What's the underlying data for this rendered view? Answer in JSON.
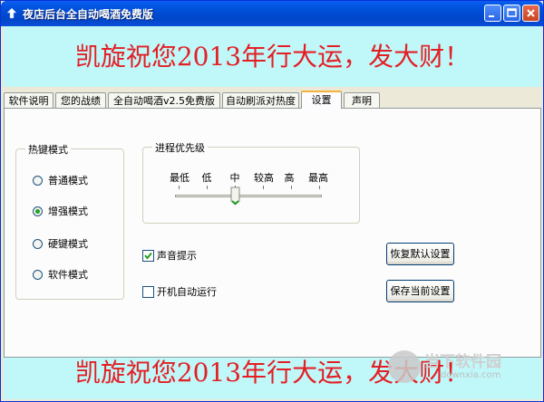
{
  "window": {
    "title": "夜店后台全自动喝酒免费版"
  },
  "banner": {
    "top_text": "凯旋祝您2013年行大运，发大财！",
    "bottom_text": "凯旋祝您2013年行大运，发大财！"
  },
  "tabs": [
    {
      "label": "软件说明",
      "active": false
    },
    {
      "label": "您的战绩",
      "active": false
    },
    {
      "label": "全自动喝酒v2.5免费版",
      "active": false
    },
    {
      "label": "自动刷派对热度",
      "active": false
    },
    {
      "label": "设置",
      "active": true
    },
    {
      "label": "声明",
      "active": false
    }
  ],
  "hotkey_group": {
    "title": "热键模式",
    "options": [
      {
        "label": "普通模式",
        "selected": false
      },
      {
        "label": "增强模式",
        "selected": true
      },
      {
        "label": "硬键模式",
        "selected": false
      },
      {
        "label": "软件模式",
        "selected": false
      }
    ]
  },
  "priority_group": {
    "title": "进程优先级",
    "levels": [
      "最低",
      "低",
      "中",
      "较高",
      "高",
      "最高"
    ],
    "selected": "中"
  },
  "options": {
    "sound_label": "声音提示",
    "sound_checked": true,
    "autostart_label": "开机自动运行",
    "autostart_checked": false
  },
  "buttons": {
    "restore_defaults": "恢复默认设置",
    "save_settings": "保存当前设置"
  },
  "watermark": {
    "text": "当下软件园",
    "sub": "downxia.com"
  },
  "colors": {
    "banner_text": "#e31f24",
    "banner_bg": "#c0f8fa",
    "titlebar": "#0052dc"
  }
}
